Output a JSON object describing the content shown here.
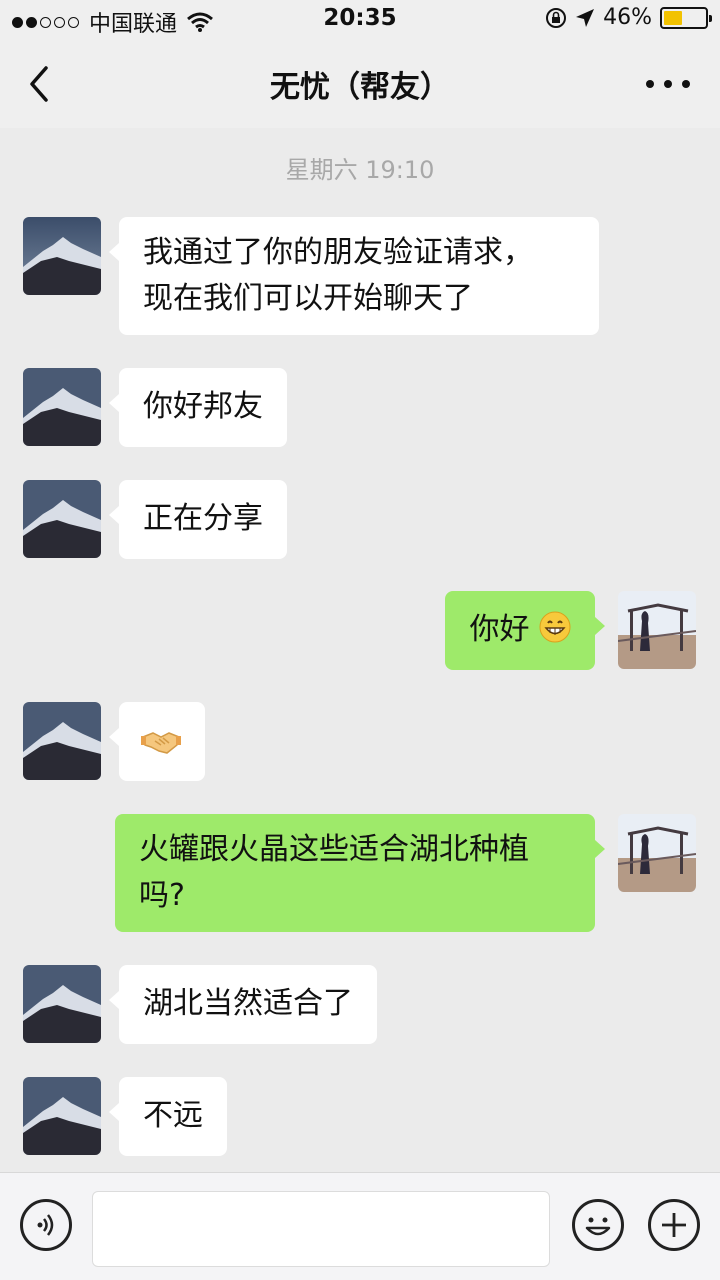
{
  "status_bar": {
    "carrier": "中国联通",
    "time": "20:35",
    "battery_percent": "46%",
    "battery_level": 0.46,
    "signal_bars": 2,
    "icons": [
      "wifi-icon",
      "orientation-lock-icon",
      "location-arrow-icon",
      "battery-icon"
    ]
  },
  "nav": {
    "title": "无忧（帮友）",
    "back_icon": "chevron-left-icon",
    "more_icon": "more-dots-icon"
  },
  "timestamp": "星期六 19:10",
  "messages": [
    {
      "from": "other",
      "lines": [
        "我通过了你的朋友验证请求，",
        "现在我们可以开始聊天了"
      ]
    },
    {
      "from": "other",
      "lines": [
        "你好邦友"
      ]
    },
    {
      "from": "other",
      "lines": [
        "正在分享"
      ]
    },
    {
      "from": "me",
      "lines": [
        "你好"
      ],
      "emoji": "grinning-face-emoji"
    },
    {
      "from": "other",
      "lines": [],
      "emoji": "handshake-emoji"
    },
    {
      "from": "me",
      "lines": [
        "火罐跟火晶这些适合湖北种植",
        "吗?"
      ]
    },
    {
      "from": "other",
      "lines": [
        "湖北当然适合了"
      ]
    },
    {
      "from": "other",
      "lines": [
        "不远"
      ]
    }
  ],
  "input_bar": {
    "placeholder": "",
    "voice_icon": "voice-icon",
    "emoji_icon": "emoji-icon",
    "plus_icon": "plus-icon"
  },
  "colors": {
    "background": "#ebebeb",
    "incoming_bubble": "#ffffff",
    "outgoing_bubble": "#9eea6a",
    "battery": "#f2c200"
  }
}
